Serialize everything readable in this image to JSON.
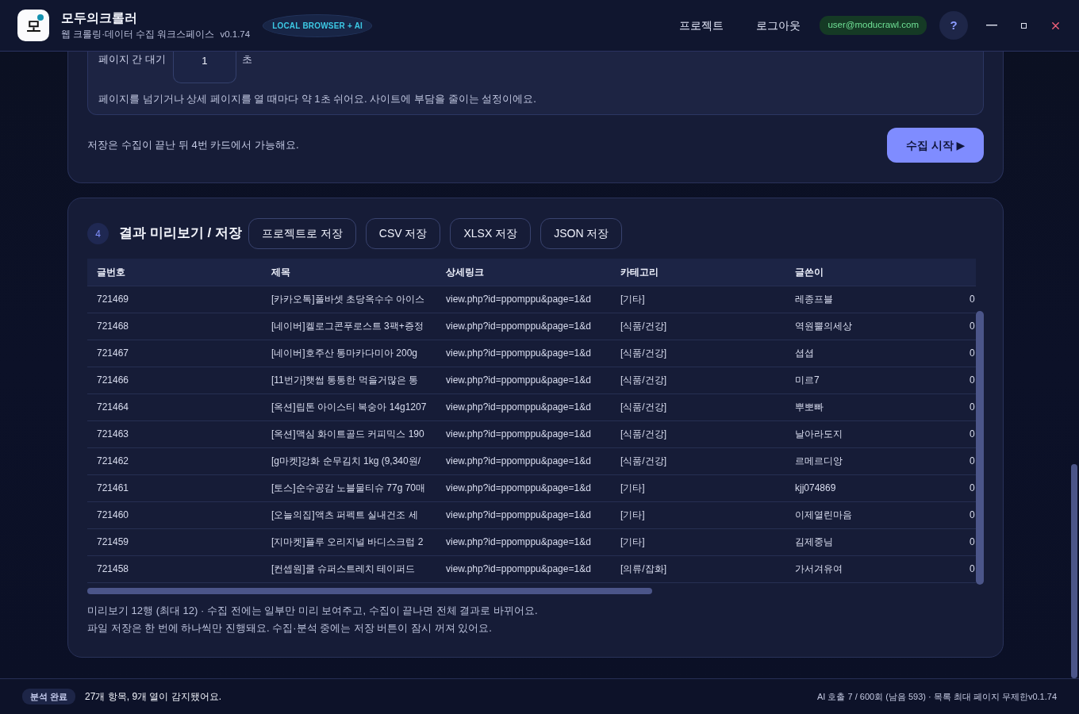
{
  "app": {
    "logo_letter": "모",
    "title": "모두의크롤러",
    "subtitle": "웹 크롤링·데이터 수집 워크스페이스",
    "version": "v0.1.74",
    "mode_badge": "LOCAL BROWSER + AI"
  },
  "nav": [
    {
      "label": "프로젝트"
    },
    {
      "label": "로그아웃"
    }
  ],
  "user_email": "user@moducrawl.com",
  "help_button": "?",
  "crawl_card": {
    "wait": {
      "label": "페이지 간 대기",
      "value": "1",
      "unit": "초",
      "hint": "페이지를 넘기거나 상세 페이지를 열 때마다 약 1초 쉬어요. 사이트에 부담을 줄이는 설정이에요."
    },
    "save_note": "저장은 수집이 끝난 뒤 4번 카드에서 가능해요.",
    "start_button": "수집 시작 ▶"
  },
  "results_card": {
    "step": "4",
    "title": "결과 미리보기 / 저장",
    "save_buttons": [
      "프로젝트로 저장",
      "CSV 저장",
      "XLSX 저장",
      "JSON 저장"
    ],
    "table": {
      "columns": [
        "글번호",
        "제목",
        "상세링크",
        "카테고리",
        "글쓴이"
      ],
      "rows": [
        [
          "721469",
          "[카카오톡]폴바셋 초당옥수수 아이스",
          "view.php?id=ppomppu&page=1&d",
          "[기타]",
          "레종프블",
          "0"
        ],
        [
          "721468",
          "[네이버]켈로그콘푸로스트 3팩+증정",
          "view.php?id=ppomppu&page=1&d",
          "[식품/건강]",
          "역원뿔의세상",
          "0"
        ],
        [
          "721467",
          "[네이버]호주산 통마카다미아 200g",
          "view.php?id=ppomppu&page=1&d",
          "[식품/건강]",
          "셥셥",
          "0"
        ],
        [
          "721466",
          "[11번가]햇썹 통통한 먹을거많은 통",
          "view.php?id=ppomppu&page=1&d",
          "[식품/건강]",
          "미르7",
          "0"
        ],
        [
          "721464",
          "[옥션]립톤 아이스티 복숭아 14g1207",
          "view.php?id=ppomppu&page=1&d",
          "[식품/건강]",
          "뿌뽀빠",
          "0"
        ],
        [
          "721463",
          "[옥션]맥심 화이트골드 커피믹스 190",
          "view.php?id=ppomppu&page=1&d",
          "[식품/건강]",
          "날아라도지",
          "0"
        ],
        [
          "721462",
          "[g마켓]강화 순무김치 1kg (9,340원/",
          "view.php?id=ppomppu&page=1&d",
          "[식품/건강]",
          "르메르디앙",
          "0"
        ],
        [
          "721461",
          "[토스]순수공감 노블물티슈 77g 70매",
          "view.php?id=ppomppu&page=1&d",
          "[기타]",
          "kjj074869",
          "0"
        ],
        [
          "721460",
          "[오늘의집]액츠 퍼펙트 실내건조 세",
          "view.php?id=ppomppu&page=1&d",
          "[기타]",
          "이제열린마음",
          "0"
        ],
        [
          "721459",
          "[지마켓]플루 오리지널 바디스크럽 2",
          "view.php?id=ppomppu&page=1&d",
          "[기타]",
          "김제중님",
          "0"
        ],
        [
          "721458",
          "[컨셉원]쿨 슈퍼스트레치 테이퍼드",
          "view.php?id=ppomppu&page=1&d",
          "[의류/잡화]",
          "가서겨유여",
          "0"
        ]
      ]
    },
    "notes": [
      "미리보기 12행 (최대 12) · 수집 전에는 일부만 미리 보여주고, 수집이 끝나면 전체 결과로 바뀌어요.",
      "파일 저장은 한 번에 하나씩만 진행돼요. 수집·분석 중에는 저장 버튼이 잠시 꺼져 있어요."
    ]
  },
  "status_bar": {
    "state": "분석 완료",
    "message": "27개 항목, 9개 열이 감지됐어요.",
    "info": "AI 호출 7 / 600회 (남음 593) · 목록 최대 페이지 무제한v0.1.74"
  }
}
